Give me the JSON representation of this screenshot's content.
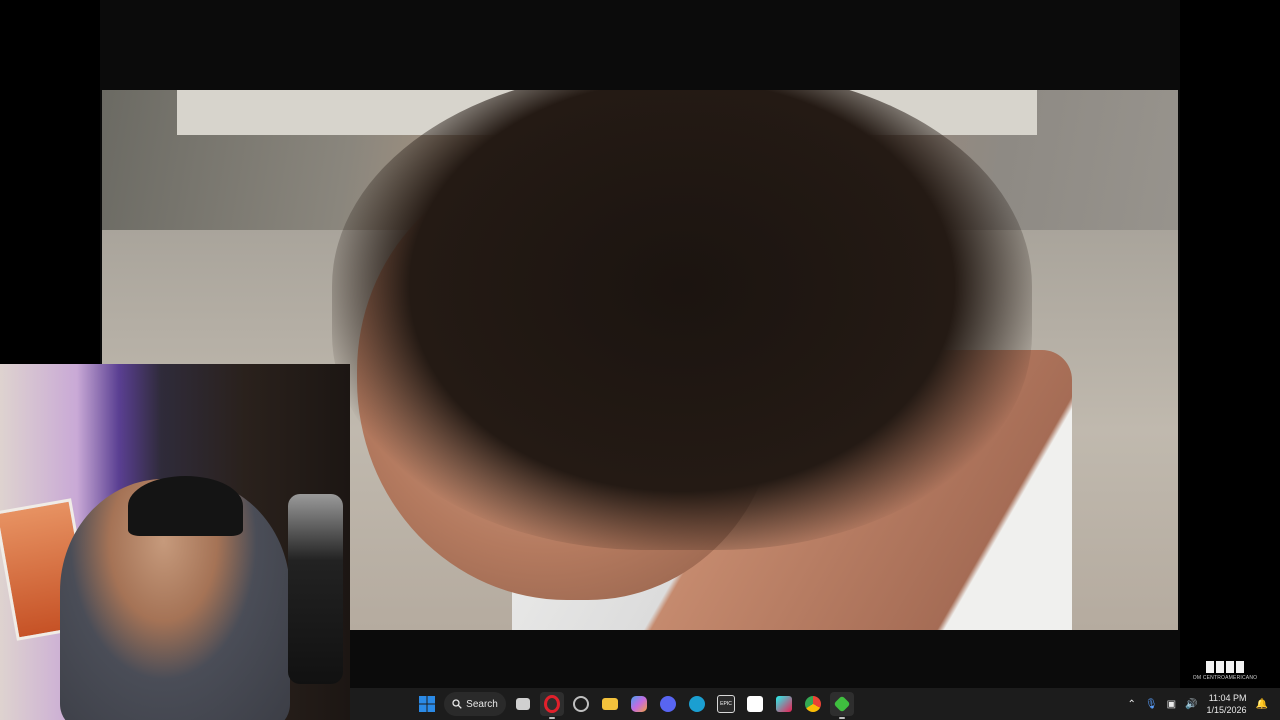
{
  "video": {
    "description_free": true
  },
  "watermark": {
    "text": "OM CENTROAMERICANO"
  },
  "taskbar": {
    "search_label": "Search",
    "apps": [
      {
        "name": "file-explorer-multitask-icon",
        "color": "#d0d0d0"
      },
      {
        "name": "opera-gx-icon",
        "color": "#e0202b"
      },
      {
        "name": "circle-app-icon",
        "color": "#bfbfbf"
      },
      {
        "name": "folder-icon",
        "color": "#f3c23c"
      },
      {
        "name": "copilot-icon",
        "color": "#4aa0f0"
      },
      {
        "name": "discord-icon",
        "color": "#5865f2"
      },
      {
        "name": "steam-icon",
        "color": "#1b9fd1"
      },
      {
        "name": "epic-games-icon",
        "color": "#2a2a2a"
      },
      {
        "name": "capcut-icon",
        "color": "#ffffff"
      },
      {
        "name": "tiktok-icon",
        "color": "#ee1d52"
      },
      {
        "name": "chrome-icon",
        "color": "#34a853"
      },
      {
        "name": "green-app-icon",
        "color": "#3fbf3f"
      }
    ],
    "epic_label": "EPIC",
    "time": "11:04 PM",
    "date": "1/15/2026"
  },
  "colors": {
    "taskbar_bg": "#1c1c1c",
    "windows_blue": "#2b8ae6"
  }
}
